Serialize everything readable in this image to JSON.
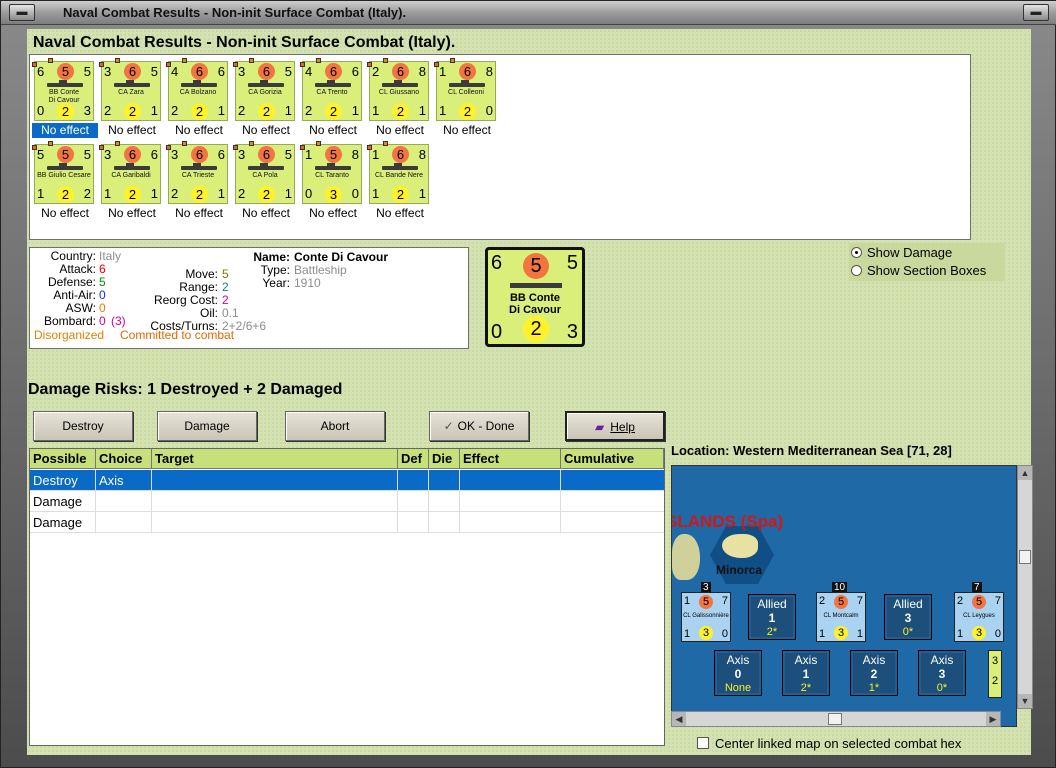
{
  "window": {
    "title": "Naval Combat Results - Non-init Surface Combat (Italy)."
  },
  "heading": "Naval Combat Results - Non-init Surface Combat (Italy).",
  "ships": [
    {
      "name1": "BB Conte",
      "name2": "Di Cavour",
      "tl": "6",
      "top": "5",
      "tr": "5",
      "bl": "0",
      "bot": "2",
      "br": "3",
      "effect": "No effect",
      "selected": true
    },
    {
      "name1": "CA Zara",
      "name2": "",
      "tl": "3",
      "top": "6",
      "tr": "5",
      "bl": "2",
      "bot": "2",
      "br": "1",
      "effect": "No effect"
    },
    {
      "name1": "CA Bolzano",
      "name2": "",
      "tl": "4",
      "top": "6",
      "tr": "6",
      "bl": "2",
      "bot": "2",
      "br": "1",
      "effect": "No effect"
    },
    {
      "name1": "CA Gorizia",
      "name2": "",
      "tl": "3",
      "top": "6",
      "tr": "5",
      "bl": "2",
      "bot": "2",
      "br": "1",
      "effect": "No effect"
    },
    {
      "name1": "CA Trento",
      "name2": "",
      "tl": "4",
      "top": "6",
      "tr": "6",
      "bl": "2",
      "bot": "2",
      "br": "1",
      "effect": "No effect"
    },
    {
      "name1": "CL Giussano",
      "name2": "",
      "tl": "2",
      "top": "6",
      "tr": "8",
      "bl": "1",
      "bot": "2",
      "br": "1",
      "effect": "No effect"
    },
    {
      "name1": "CL Colleoni",
      "name2": "",
      "tl": "1",
      "top": "6",
      "tr": "8",
      "bl": "1",
      "bot": "2",
      "br": "0",
      "effect": "No effect"
    },
    {
      "name1": "BB Giulio Cesare",
      "name2": "",
      "tl": "5",
      "top": "5",
      "tr": "5",
      "bl": "1",
      "bot": "2",
      "br": "2",
      "effect": "No effect"
    },
    {
      "name1": "CA Garibaldi",
      "name2": "",
      "tl": "3",
      "top": "6",
      "tr": "6",
      "bl": "1",
      "bot": "2",
      "br": "1",
      "effect": "No effect"
    },
    {
      "name1": "CA Trieste",
      "name2": "",
      "tl": "3",
      "top": "6",
      "tr": "6",
      "bl": "2",
      "bot": "2",
      "br": "1",
      "effect": "No effect"
    },
    {
      "name1": "CA Pola",
      "name2": "",
      "tl": "3",
      "top": "6",
      "tr": "5",
      "bl": "2",
      "bot": "2",
      "br": "1",
      "effect": "No effect"
    },
    {
      "name1": "CL Taranto",
      "name2": "",
      "tl": "1",
      "top": "5",
      "tr": "8",
      "bl": "0",
      "bot": "3",
      "br": "0",
      "effect": "No effect"
    },
    {
      "name1": "CL Bande Nere",
      "name2": "",
      "tl": "1",
      "top": "6",
      "tr": "8",
      "bl": "1",
      "bot": "2",
      "br": "1",
      "effect": "No effect"
    }
  ],
  "info": {
    "country_label": "Country:",
    "country": "Italy",
    "attack_label": "Attack:",
    "attack": "6",
    "defense_label": "Defense:",
    "defense": "5",
    "antiair_label": "Anti-Air:",
    "antiair": "0",
    "asw_label": "ASW:",
    "asw": "0",
    "bombard_label": "Bombard:",
    "bombard": "0",
    "bombard_paren": "(3)",
    "status_disorg": "Disorganized",
    "status_committed": "Committed to combat",
    "name_label": "Name:",
    "name": "Conte Di Cavour",
    "type_label": "Type:",
    "type": "Battleship",
    "year_label": "Year:",
    "year": "1910",
    "move_label": "Move:",
    "move": "5",
    "range_label": "Range:",
    "range": "2",
    "reorg_label": "Reorg Cost:",
    "reorg": "2",
    "oil_label": "Oil:",
    "oil": "0.1",
    "costs_label": "Costs/Turns:",
    "costs": "2+2/6+6"
  },
  "big_counter": {
    "tl": "6",
    "top": "5",
    "tr": "5",
    "bl": "0",
    "bot": "2",
    "br": "3",
    "name1": "BB Conte",
    "name2": "Di Cavour"
  },
  "radio": {
    "show_damage": "Show Damage",
    "show_sections": "Show Section Boxes"
  },
  "damage_risks": "Damage Risks:  1 Destroyed + 2 Damaged",
  "buttons": {
    "destroy": "Destroy",
    "damage": "Damage",
    "abort": "Abort",
    "ok": "OK - Done",
    "help": "Help"
  },
  "table": {
    "headers": [
      "Possible",
      "Choice",
      "Target",
      "Def",
      "Die",
      "Effect",
      "Cumulative"
    ],
    "rows": [
      {
        "possible": "Destroy",
        "choice": "Axis"
      },
      {
        "possible": "Damage",
        "choice": ""
      },
      {
        "possible": "Damage",
        "choice": ""
      }
    ]
  },
  "location": "Location:  Western Mediterranean Sea [71, 28]",
  "map": {
    "region_title": "SLANDS (Spa)",
    "island_name": "Minorca",
    "counters": [
      {
        "name": "CL Galissonnière",
        "tl": "1",
        "top": "5",
        "tr": "7",
        "bl": "1",
        "bot": "3",
        "br": "0",
        "badge": "3"
      },
      {
        "name": "CL Montcalm",
        "tl": "2",
        "top": "5",
        "tr": "7",
        "bl": "1",
        "bot": "3",
        "br": "1",
        "badge": "10"
      },
      {
        "name": "CL Leygues",
        "tl": "2",
        "top": "5",
        "tr": "7",
        "bl": "1",
        "bot": "3",
        "br": "0",
        "badge": "7"
      }
    ],
    "allied_boxes": [
      {
        "label": "Allied",
        "num": "1",
        "sub": "2*"
      },
      {
        "label": "Allied",
        "num": "3",
        "sub": "0*"
      }
    ],
    "axis_boxes": [
      {
        "label": "Axis",
        "num": "0",
        "sub": "None"
      },
      {
        "label": "Axis",
        "num": "1",
        "sub": "2*"
      },
      {
        "label": "Axis",
        "num": "2",
        "sub": "1*"
      },
      {
        "label": "Axis",
        "num": "3",
        "sub": "0*"
      }
    ],
    "edge_top": "3",
    "edge_bot": "2"
  },
  "center_map_label": "Center linked map on selected combat hex",
  "icons": {
    "check": "check-icon",
    "help_book": "help-book-icon"
  }
}
